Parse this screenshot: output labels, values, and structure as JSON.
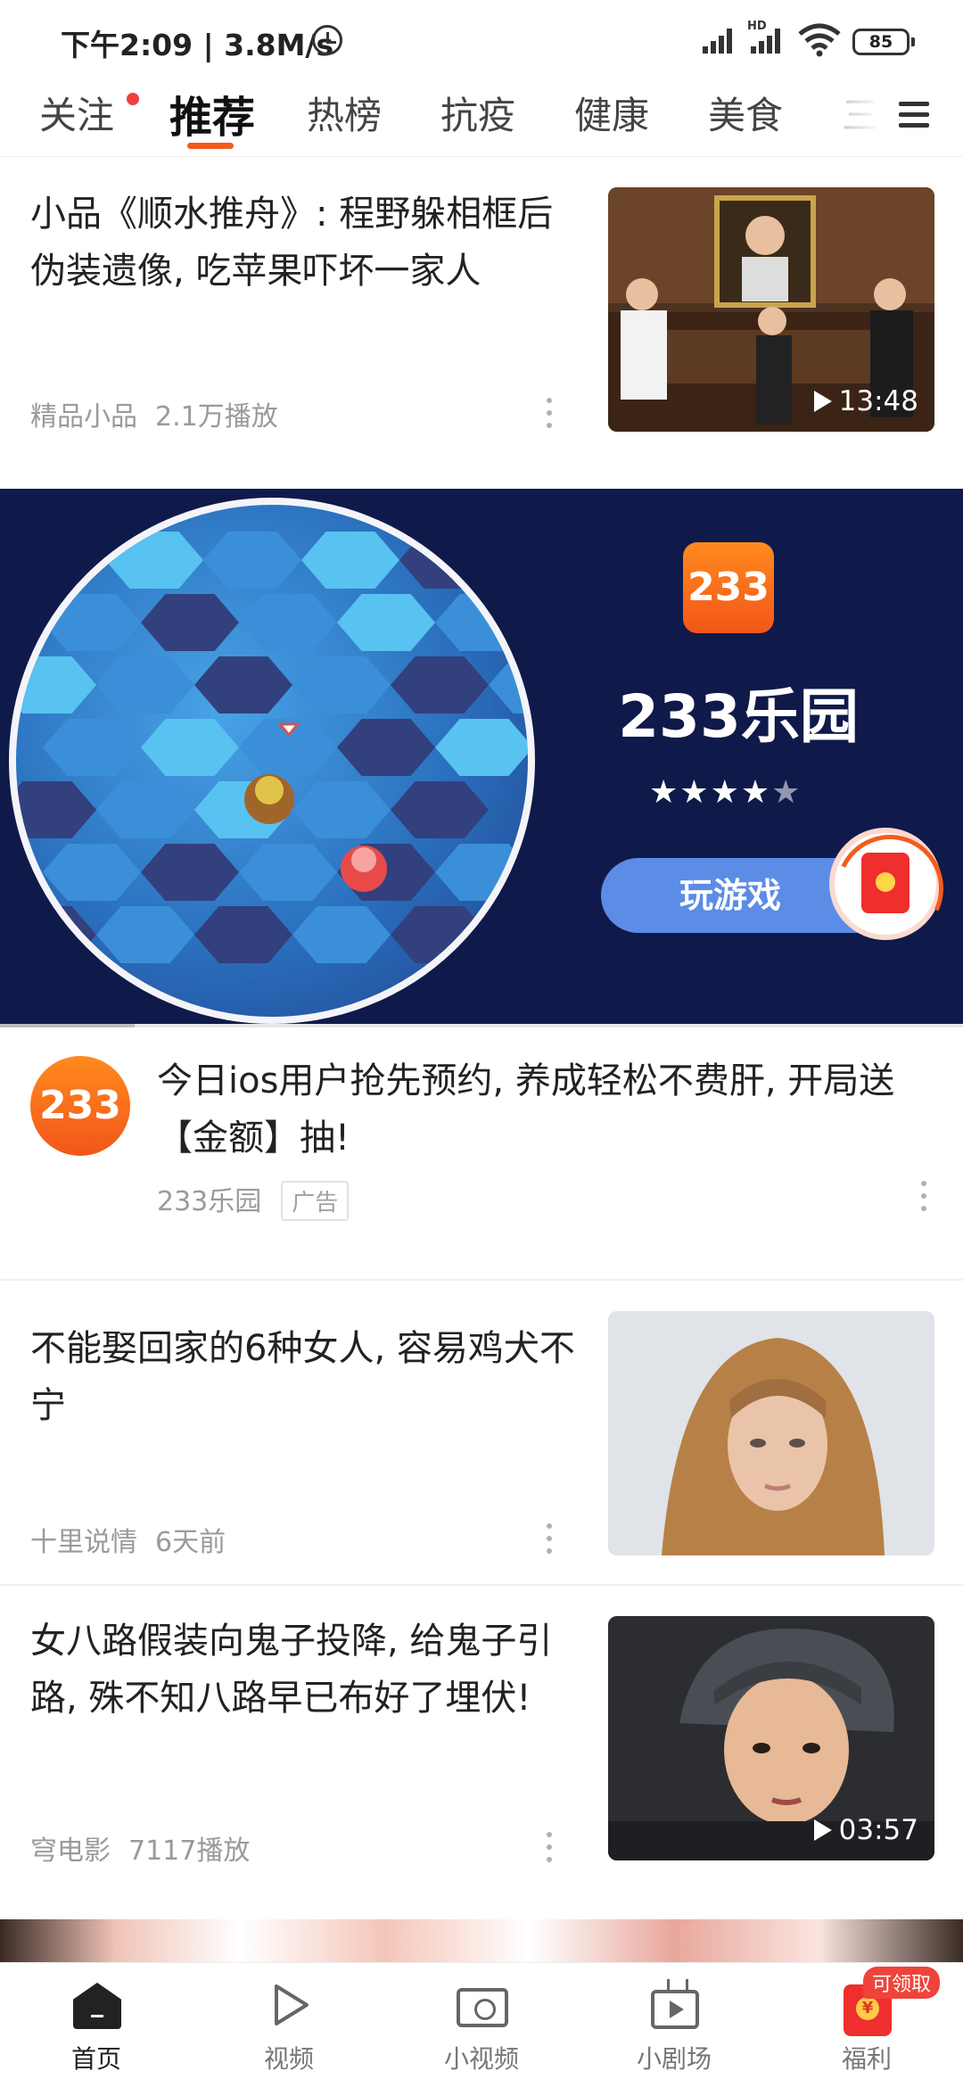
{
  "status_bar": {
    "time": "下午2:09 | 3.8M/s",
    "hd": "HD",
    "battery": "85"
  },
  "tabs": [
    {
      "label": "关注",
      "active": false,
      "has_dot": true
    },
    {
      "label": "推荐",
      "active": true
    },
    {
      "label": "热榜",
      "active": false
    },
    {
      "label": "抗疫",
      "active": false
    },
    {
      "label": "健康",
      "active": false
    },
    {
      "label": "美食",
      "active": false
    },
    {
      "label": "三",
      "active": false
    }
  ],
  "articles": [
    {
      "title": "小品《顺水推舟》: 程野躲相框后伪装遗像, 吃苹果吓坏一家人",
      "source": "精品小品",
      "stat": "2.1万播放",
      "duration": "13:48",
      "thumbnail": "skit-stage-portrait-frame"
    },
    {
      "title": "不能娶回家的6种女人, 容易鸡犬不宁",
      "source": "十里说情",
      "stat": "6天前",
      "thumbnail": "woman-headscarf-veil"
    },
    {
      "title": "女八路假装向鬼子投降, 给鬼子引路, 殊不知八路早已布好了埋伏!",
      "source": "穹电影",
      "stat": "7117播放",
      "duration": "03:57",
      "thumbnail": "woman-knit-hat-drama"
    }
  ],
  "ad": {
    "app_logo_text": "233",
    "app_name": "233乐园",
    "rating": 4.5,
    "play_button": "玩游戏",
    "title": "今日ios用户抢先预约, 养成轻松不费肝, 开局送【金额】抽!",
    "source": "233乐园",
    "tag": "广告",
    "video_progress": 0.14
  },
  "bottom_nav": [
    {
      "label": "首页",
      "icon": "home-icon",
      "active": true
    },
    {
      "label": "视频",
      "icon": "play-icon",
      "active": false
    },
    {
      "label": "小视频",
      "icon": "camera-icon",
      "active": false
    },
    {
      "label": "小剧场",
      "icon": "tv-icon",
      "active": false
    },
    {
      "label": "福利",
      "icon": "red-packet-icon",
      "active": false,
      "badge": "可领取"
    }
  ],
  "colors": {
    "accent": "#f45b1e",
    "ad_background": "#0f1a4a",
    "play_button": "#5b8ce6"
  }
}
